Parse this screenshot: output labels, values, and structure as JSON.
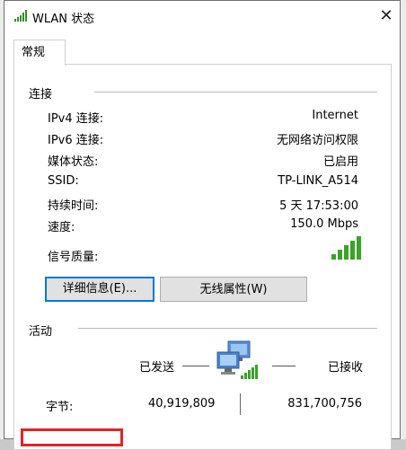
{
  "window": {
    "title": "WLAN 状态",
    "close_glyph": "✕"
  },
  "tab": {
    "label": "常规"
  },
  "connection": {
    "heading": "连接",
    "rows": [
      {
        "label": "IPv4 连接:",
        "value": "Internet"
      },
      {
        "label": "IPv6 连接:",
        "value": "无网络访问权限"
      },
      {
        "label": "媒体状态:",
        "value": "已启用"
      },
      {
        "label": "SSID:",
        "value": "TP-LINK_A514"
      },
      {
        "label": "持续时间:",
        "value": "5 天 17:53:00"
      },
      {
        "label": "速度:",
        "value": "150.0 Mbps"
      }
    ],
    "signal_label": "信号质量:",
    "signal_bars": 5,
    "signal_color": "#3aa12b"
  },
  "buttons": {
    "details": "详细信息(E)...",
    "wireless_props": "无线属性(W)"
  },
  "activity": {
    "heading": "活动",
    "sent_label": "已发送",
    "received_label": "已接收",
    "bytes_label": "字节:",
    "bytes_sent": "40,919,809",
    "bytes_received": "831,700,756"
  },
  "icons": {
    "title": "wifi-signal-icon",
    "signal": "signal-bars-icon",
    "activity": "network-computers-icon"
  },
  "colors": {
    "accent": "#0078d7",
    "highlight_box": "#e02424"
  }
}
